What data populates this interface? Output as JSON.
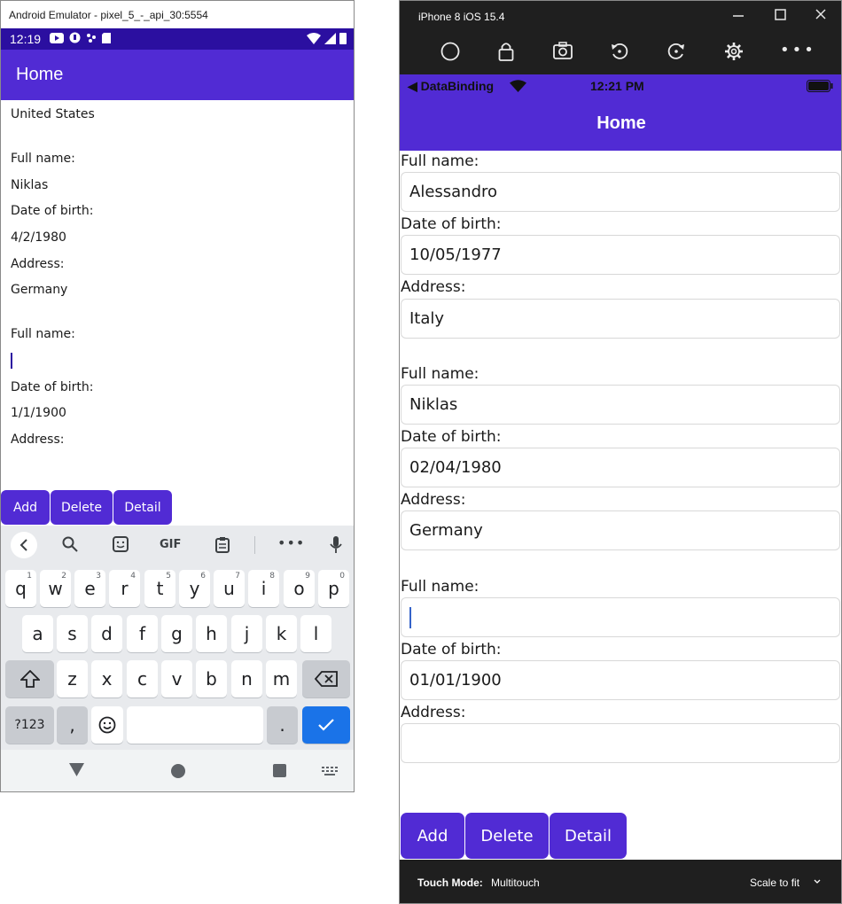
{
  "android": {
    "window_title": "Android Emulator - pixel_5_-_api_30:5554",
    "status": {
      "time": "12:19"
    },
    "app_title": "Home",
    "rows": [
      {
        "text": "United States"
      },
      {
        "text": "Full name:"
      },
      {
        "text": "Niklas"
      },
      {
        "text": "Date of birth:"
      },
      {
        "text": "4/2/1980"
      },
      {
        "text": "Address:"
      },
      {
        "text": "Germany"
      },
      {
        "text": "Full name:"
      },
      {
        "text": "Date of birth:"
      },
      {
        "text": "1/1/1900"
      },
      {
        "text": "Address:"
      }
    ],
    "buttons": [
      "Add",
      "Delete",
      "Detail"
    ],
    "keyboard": {
      "gif_label": "GIF",
      "row1": [
        "q",
        "w",
        "e",
        "r",
        "t",
        "y",
        "u",
        "i",
        "o",
        "p"
      ],
      "row1_hints": [
        "1",
        "2",
        "3",
        "4",
        "5",
        "6",
        "7",
        "8",
        "9",
        "0"
      ],
      "row2": [
        "a",
        "s",
        "d",
        "f",
        "g",
        "h",
        "j",
        "k",
        "l"
      ],
      "row3": [
        "z",
        "x",
        "c",
        "v",
        "b",
        "n",
        "m"
      ],
      "symbols": "?123",
      "comma": ",",
      "period": "."
    },
    "icons": [
      "back-icon",
      "search-icon",
      "sticker-icon",
      "clipboard-icon",
      "more-icon",
      "mic-icon",
      "shift-icon",
      "backspace-icon",
      "emoji-icon",
      "check-icon"
    ]
  },
  "ios": {
    "window_title": "iPhone 8 iOS 15.4",
    "status": {
      "back_app": "◀ DataBinding",
      "time": "12:21 PM"
    },
    "nav_title": "Home",
    "fields": [
      {
        "label": "Full name:",
        "value": "Alessandro"
      },
      {
        "label": "Date of birth:",
        "value": "10/05/1977"
      },
      {
        "label": "Address:",
        "value": "Italy"
      },
      {
        "label": "Full name:",
        "value": "Niklas"
      },
      {
        "label": "Date of birth:",
        "value": "02/04/1980"
      },
      {
        "label": "Address:",
        "value": "Germany"
      },
      {
        "label": "Full name:",
        "value": ""
      },
      {
        "label": "Date of birth:",
        "value": "01/01/1900"
      },
      {
        "label": "Address:",
        "value": ""
      }
    ],
    "buttons": [
      "Add",
      "Delete",
      "Detail"
    ],
    "footer": {
      "touch_label": "Touch Mode:",
      "touch_value": "Multitouch",
      "scale": "Scale to fit"
    }
  },
  "colors": {
    "brand": "#512bd4",
    "android_status": "#2b0fa0",
    "key_blue": "#1a73e8"
  }
}
